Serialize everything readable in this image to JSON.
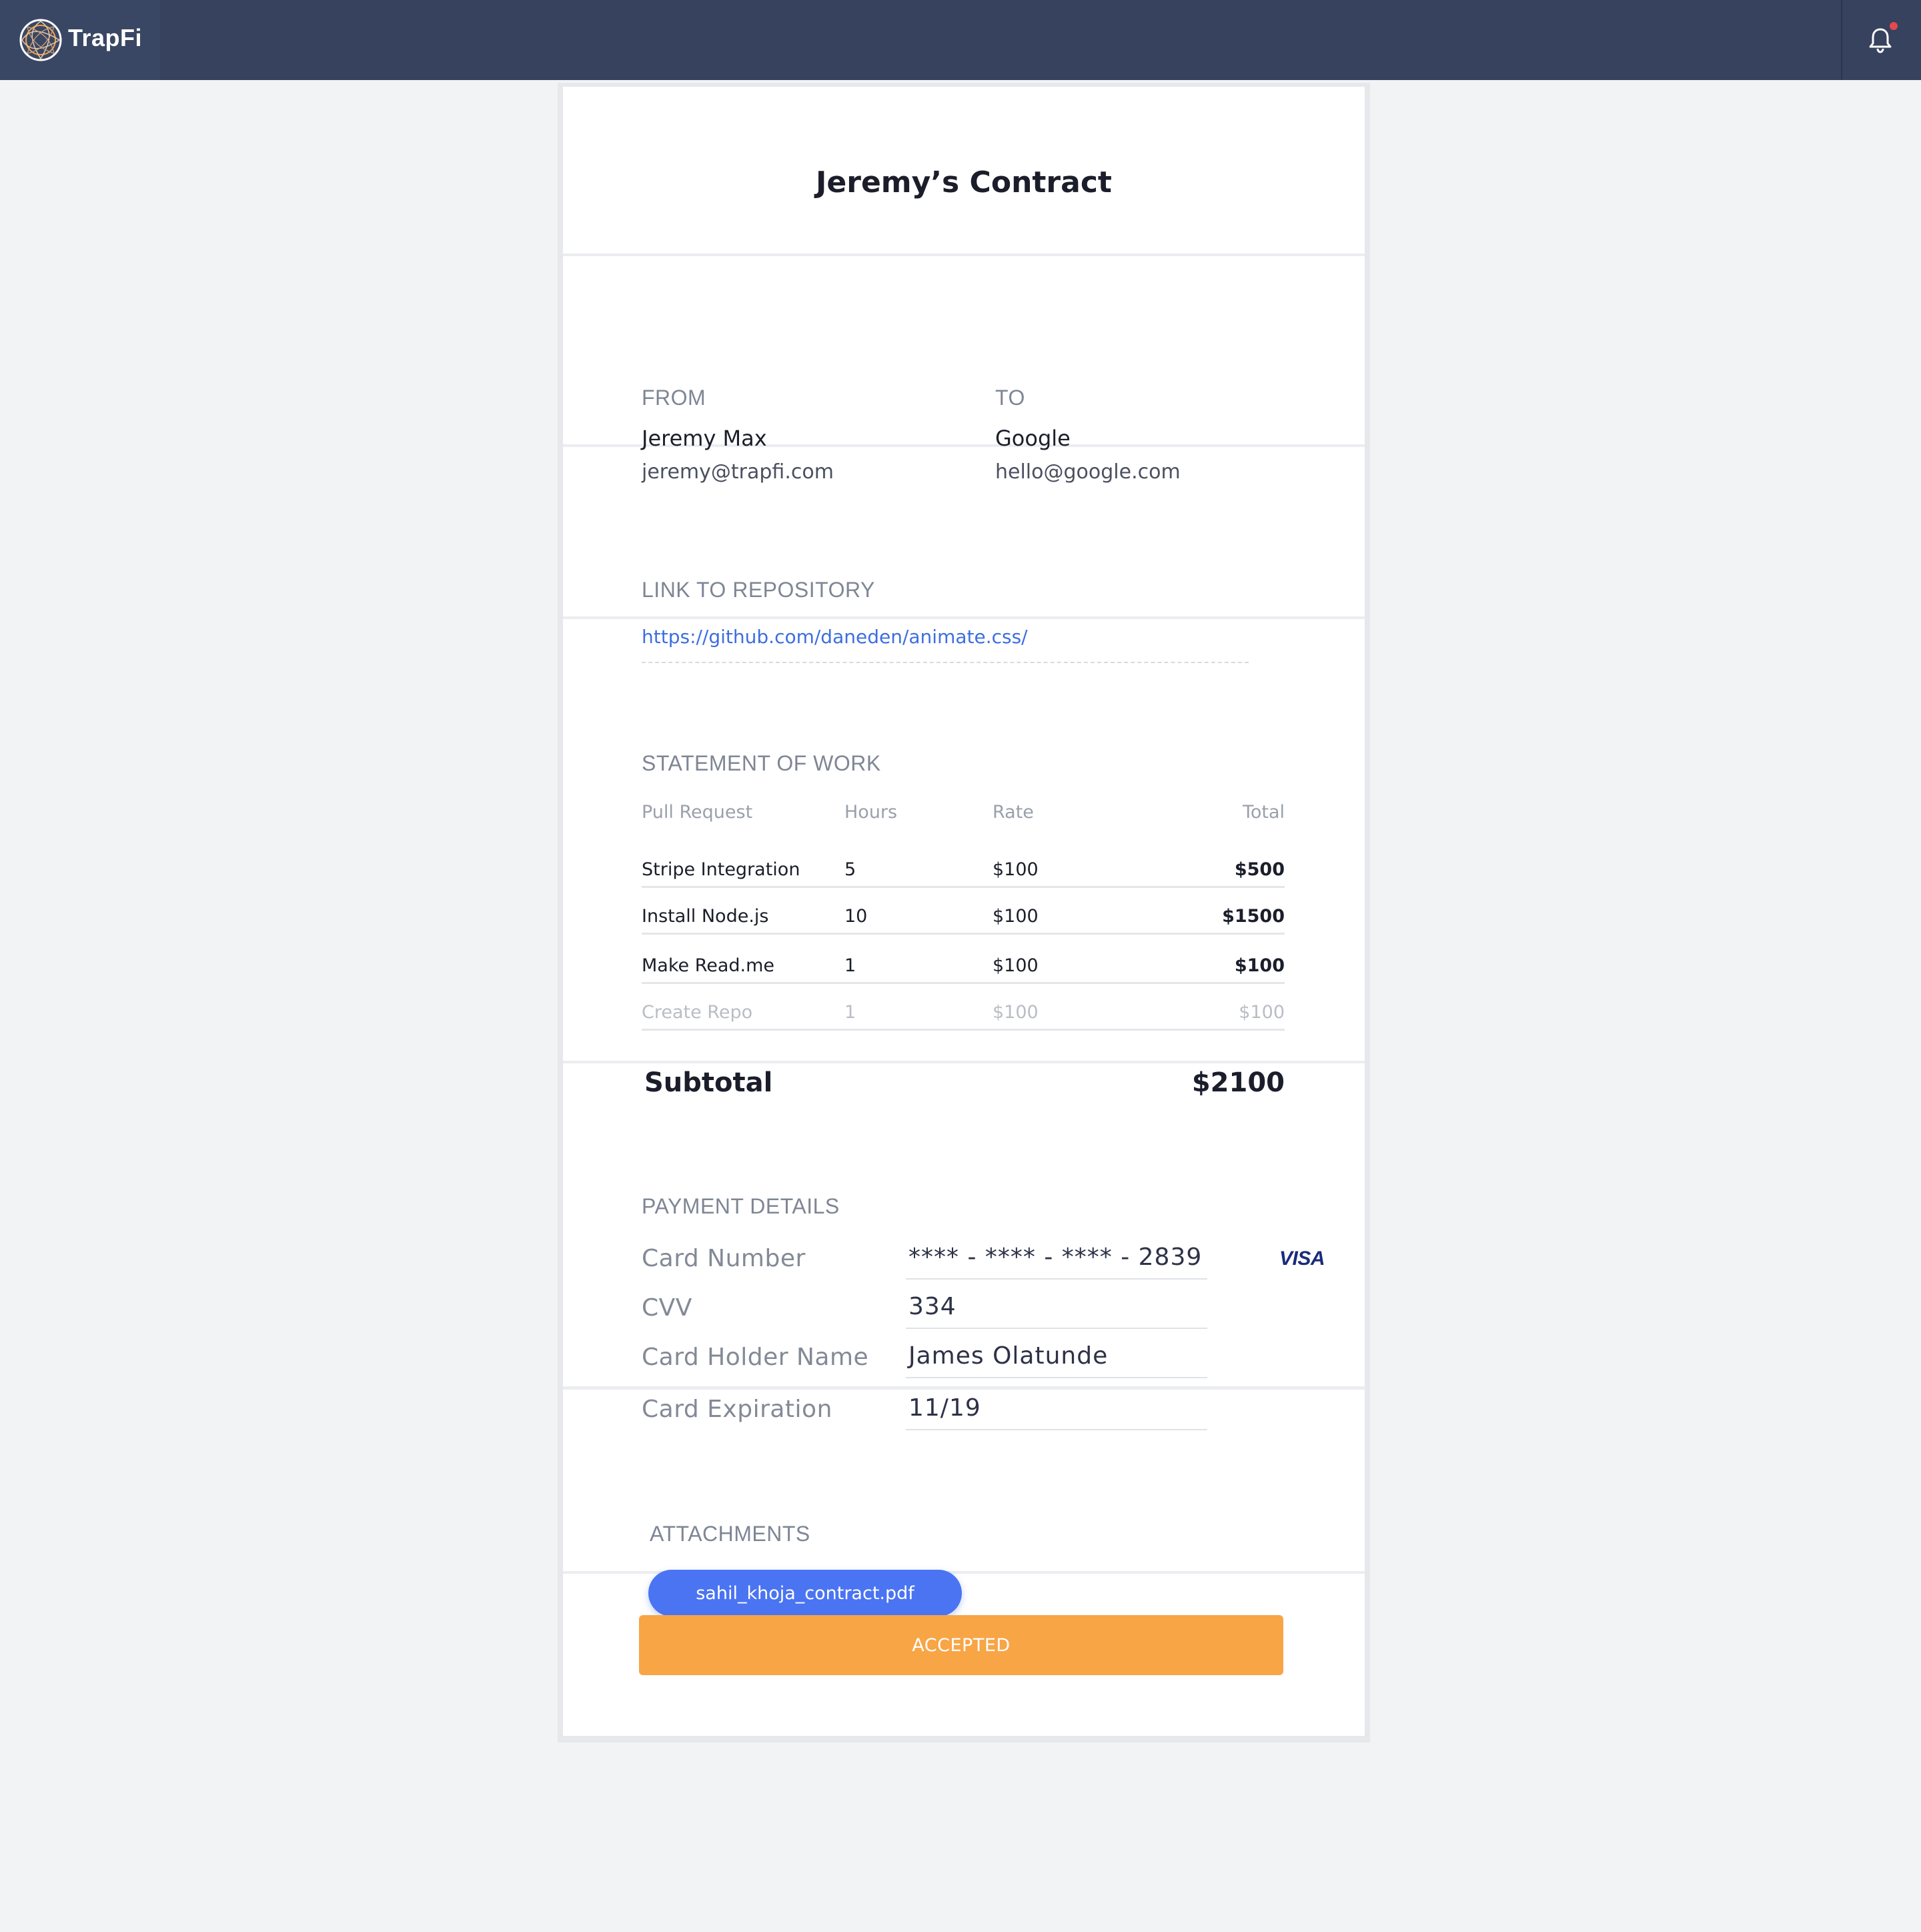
{
  "app": {
    "name": "TrapFi",
    "notification_dot_color": "#e5484d"
  },
  "contract": {
    "title": "Jeremy’s Contract",
    "from": {
      "label": "FROM",
      "name": "Jeremy Max",
      "email": "jeremy@trapfi.com"
    },
    "to": {
      "label": "TO",
      "name": "Google",
      "email": "hello@google.com"
    },
    "repository": {
      "label": "LINK TO REPOSITORY",
      "url": "https://github.com/daneden/animate.css/"
    },
    "statement": {
      "label": "STATEMENT OF WORK",
      "columns": [
        "Pull Request",
        "Hours",
        "Rate",
        "Total"
      ],
      "rows": [
        {
          "pull_request": "Stripe Integration",
          "hours": "5",
          "rate": "$100",
          "total": "$500"
        },
        {
          "pull_request": "Install Node.js",
          "hours": "10",
          "rate": "$100",
          "total": "$1500"
        },
        {
          "pull_request": "Make Read.me",
          "hours": "1",
          "rate": "$100",
          "total": "$100"
        },
        {
          "pull_request": "Create Repo",
          "hours": "1",
          "rate": "$100",
          "total": "$100",
          "muted": true
        }
      ],
      "subtotal_label": "Subtotal",
      "subtotal_value": "$2100"
    },
    "payment": {
      "label": "PAYMENT DETAILS",
      "card_number_label": "Card Number",
      "card_number": "**** - **** - **** - 2839",
      "card_brand": "VISA",
      "cvv_label": "CVV",
      "cvv": "334",
      "holder_label": "Card Holder Name",
      "holder": "James Olatunde",
      "expiration_label": "Card Expiration",
      "expiration": "11/19"
    },
    "attachments": {
      "label": "ATTACHMENTS",
      "files": [
        "sahil_khoja_contract.pdf"
      ]
    },
    "status_button": "ACCEPTED"
  },
  "colors": {
    "topbar": "#36425e",
    "link": "#3d6ee0",
    "attachment_button": "#4a74f2",
    "accepted_button": "#f8a546",
    "visa": "#1a2b7a"
  }
}
